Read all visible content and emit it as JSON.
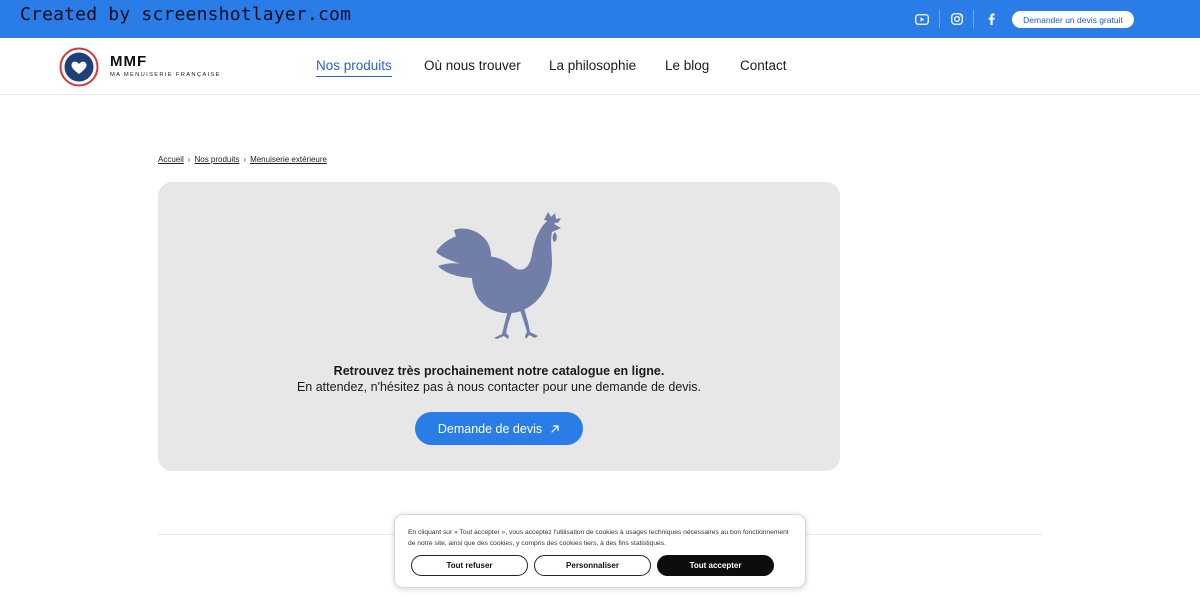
{
  "watermark": "Created by screenshotlayer.com",
  "topbar": {
    "social": [
      "youtube-icon",
      "instagram-icon",
      "facebook-icon"
    ],
    "quote_button": "Demander un devis gratuit",
    "color": "#2a7de6"
  },
  "logo": {
    "title": "MMF",
    "subtitle": "MA MENUISERIE FRANÇAISE"
  },
  "nav": {
    "items": [
      {
        "label": "Nos produits",
        "active": true
      },
      {
        "label": "Où nous trouver",
        "active": false
      },
      {
        "label": "La philosophie",
        "active": false
      },
      {
        "label": "Le blog",
        "active": false
      },
      {
        "label": "Contact",
        "active": false
      }
    ]
  },
  "breadcrumb": [
    "Accueil",
    "Nos produits",
    "Menuiserie extérieure"
  ],
  "card": {
    "title": "Retrouvez très prochainement notre catalogue en ligne.",
    "text": "En attendez, n'hésitez pas à nous contacter pour une demande de devis.",
    "cta": "Demande de devis",
    "cta_icon": "arrow-up-right-icon",
    "illustration": "rooster-icon",
    "illustration_color": "#717fa8"
  },
  "cookie": {
    "text": "En cliquant sur « Tout accepter », vous acceptez l'utilisation de cookies à usages techniques nécessaires au bon fonctionnement de notre site, ainsi que des cookies, y compris des cookies tiers, à des fins statistiques.",
    "refuse": "Tout refuser",
    "customize": "Personnaliser",
    "accept": "Tout accepter"
  }
}
